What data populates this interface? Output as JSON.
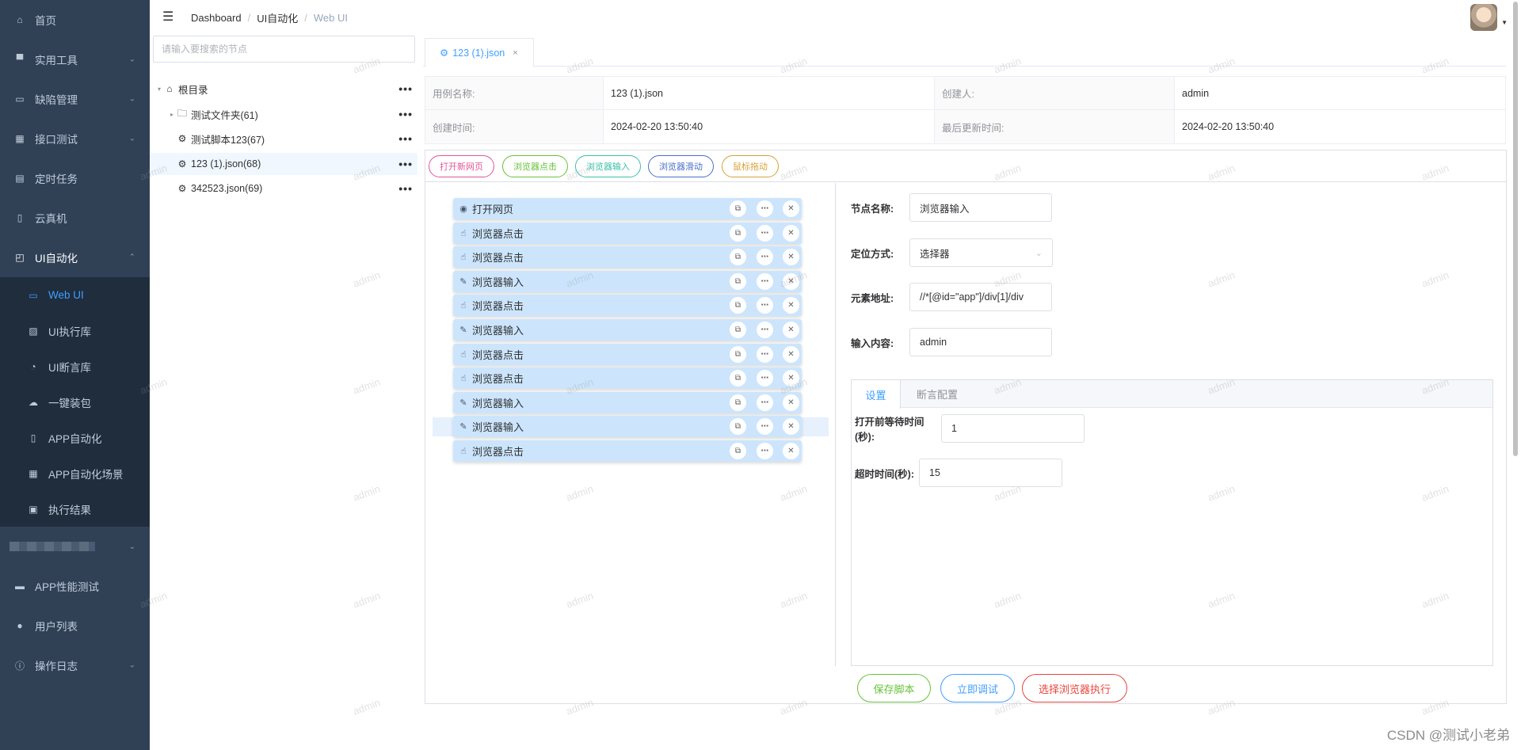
{
  "sidebar": {
    "items": [
      {
        "label": "首页",
        "icon": "home-icon"
      },
      {
        "label": "实用工具",
        "icon": "tools-icon"
      },
      {
        "label": "缺陷管理",
        "icon": "briefcase-icon"
      },
      {
        "label": "接口测试",
        "icon": "grid-icon"
      },
      {
        "label": "定时任务",
        "icon": "clipboard-icon"
      },
      {
        "label": "云真机",
        "icon": "phone-icon"
      },
      {
        "label": "UI自动化",
        "icon": "easel-icon"
      }
    ],
    "submenu": [
      {
        "label": "Web UI",
        "icon": "monitor-icon"
      },
      {
        "label": "UI执行库",
        "icon": "image-icon"
      },
      {
        "label": "UI断言库",
        "icon": "gauge-icon"
      },
      {
        "label": "一键装包",
        "icon": "upload-cloud-icon"
      },
      {
        "label": "APP自动化",
        "icon": "mobile-icon"
      },
      {
        "label": "APP自动化场景",
        "icon": "calendar-icon"
      },
      {
        "label": "执行结果",
        "icon": "checklist-icon"
      }
    ],
    "bottom_items": [
      {
        "label": "APP性能测试",
        "icon": "monitor-icon"
      },
      {
        "label": "用户列表",
        "icon": "user-icon"
      },
      {
        "label": "操作日志",
        "icon": "info-icon"
      }
    ]
  },
  "breadcrumb": {
    "items": [
      "Dashboard",
      "UI自动化",
      "Web UI"
    ],
    "sep": "/"
  },
  "tree": {
    "search_placeholder": "请输入要搜索的节点",
    "nodes": [
      {
        "label": "根目录",
        "level": 0
      },
      {
        "label": "测试文件夹(61)",
        "level": 1
      },
      {
        "label": "测试脚本123(67)",
        "level": 1
      },
      {
        "label": "123 (1).json(68)",
        "level": 1,
        "selected": true
      },
      {
        "label": "342523.json(69)",
        "level": 1
      }
    ],
    "more": "•••"
  },
  "tab": {
    "label": "123 (1).json",
    "close": "×"
  },
  "info": {
    "name_label": "用例名称:",
    "name_value": "123 (1).json",
    "creator_label": "创建人:",
    "creator_value": "admin",
    "created_label": "创建时间:",
    "created_value": "2024-02-20 13:50:40",
    "updated_label": "最后更新时间:",
    "updated_value": "2024-02-20 13:50:40"
  },
  "toolbar": {
    "buttons": [
      {
        "label": "打开新网页",
        "color": "#e0569b"
      },
      {
        "label": "浏览器点击",
        "color": "#67c23a"
      },
      {
        "label": "浏览器输入",
        "color": "#3bbfa9"
      },
      {
        "label": "浏览器滑动",
        "color": "#4a6fc7"
      },
      {
        "label": "鼠标拖动",
        "color": "#d6a23a"
      }
    ]
  },
  "steps": [
    {
      "label": "打开网页",
      "icon": "eye-icon"
    },
    {
      "label": "浏览器点击",
      "icon": "hand-pointer-icon"
    },
    {
      "label": "浏览器点击",
      "icon": "hand-pointer-icon"
    },
    {
      "label": "浏览器输入",
      "icon": "pencil-icon"
    },
    {
      "label": "浏览器点击",
      "icon": "hand-pointer-icon"
    },
    {
      "label": "浏览器输入",
      "icon": "pencil-icon"
    },
    {
      "label": "浏览器点击",
      "icon": "hand-pointer-icon"
    },
    {
      "label": "浏览器点击",
      "icon": "hand-pointer-icon"
    },
    {
      "label": "浏览器输入",
      "icon": "pencil-icon"
    },
    {
      "label": "浏览器输入",
      "icon": "pencil-icon"
    },
    {
      "label": "浏览器点击",
      "icon": "hand-pointer-icon"
    }
  ],
  "step_highlight_index": 9,
  "config": {
    "node_name_label": "节点名称:",
    "node_name_value": "浏览器输入",
    "locate_label": "定位方式:",
    "locate_value": "选择器",
    "element_label": "元素地址:",
    "element_value": "//*[@id=\"app\"]/div[1]/div",
    "input_label": "输入内容:",
    "input_value": "admin",
    "tabs": [
      "设置",
      "断言配置"
    ],
    "wait_label": "打开前等待时间(秒):",
    "wait_value": "1",
    "timeout_label": "超时时间(秒):",
    "timeout_value": "15"
  },
  "actions": {
    "save": {
      "label": "保存脚本",
      "color": "#67c23a"
    },
    "debug": {
      "label": "立即调试",
      "color": "#409eff"
    },
    "run": {
      "label": "选择浏览器执行",
      "color": "#e6453c"
    }
  },
  "watermark": "admin",
  "csdn": "CSDN @测试小老弟"
}
